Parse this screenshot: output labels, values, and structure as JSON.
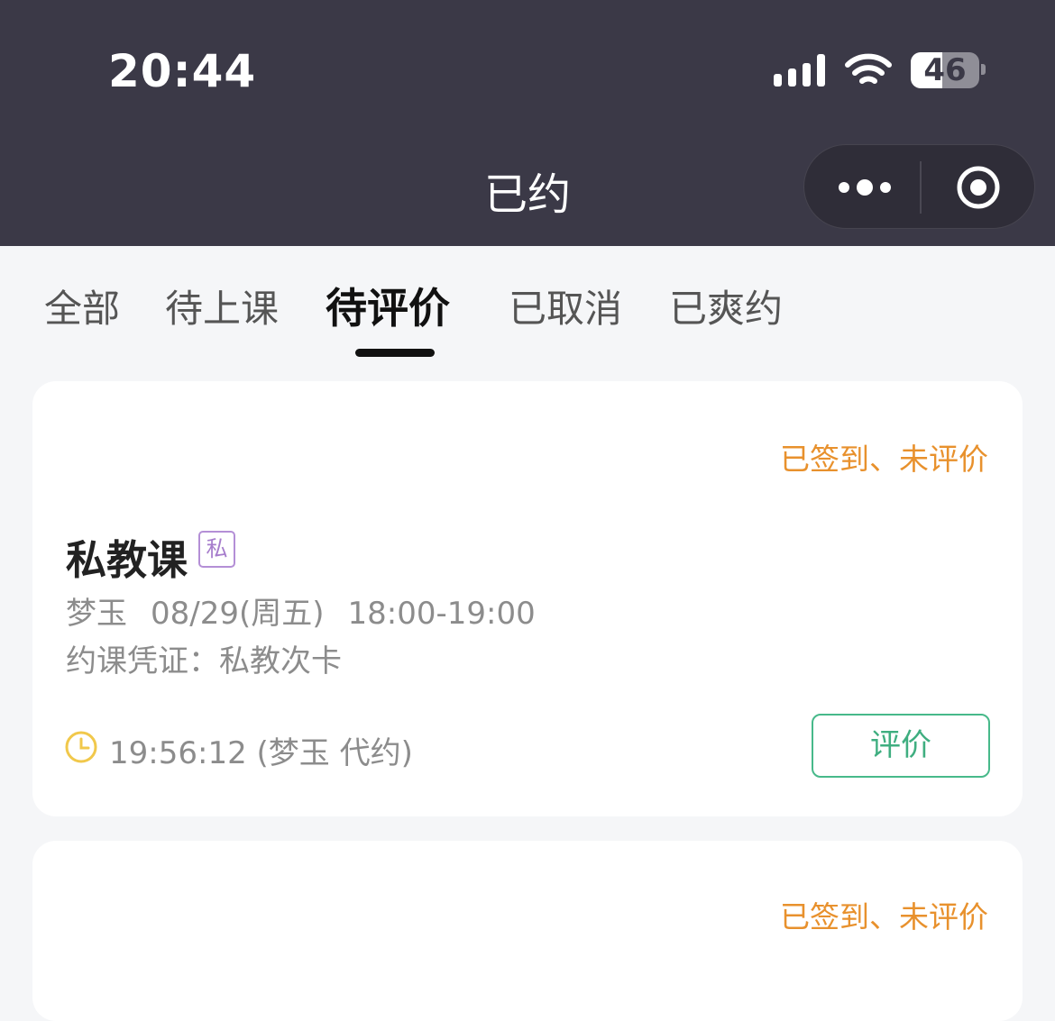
{
  "status_bar": {
    "time": "20:44",
    "battery": "46"
  },
  "nav": {
    "title": "已约"
  },
  "tabs": {
    "items": [
      {
        "label": "全部"
      },
      {
        "label": "待上课"
      },
      {
        "label": "待评价"
      },
      {
        "label": "已取消"
      },
      {
        "label": "已爽约"
      }
    ],
    "active_index": 2
  },
  "bookings": [
    {
      "status": "已签到、未评价",
      "title": "私教课",
      "tag": "私",
      "coach": "梦玉",
      "date": "08/29(周五)",
      "time_range": "18:00-19:00",
      "credential": "约课凭证：私教次卡",
      "booked_at": "19:56:12 (梦玉 代约)",
      "action_label": "评价"
    },
    {
      "status": "已签到、未评价"
    }
  ],
  "colors": {
    "header_bg": "#3b3947",
    "status_orange": "#e8912d",
    "action_green": "#47b98a",
    "tag_purple": "#b48fd6"
  },
  "icons": [
    "signal-icon",
    "wifi-icon",
    "battery-icon",
    "more-icon",
    "close-target-icon",
    "clock-icon"
  ]
}
